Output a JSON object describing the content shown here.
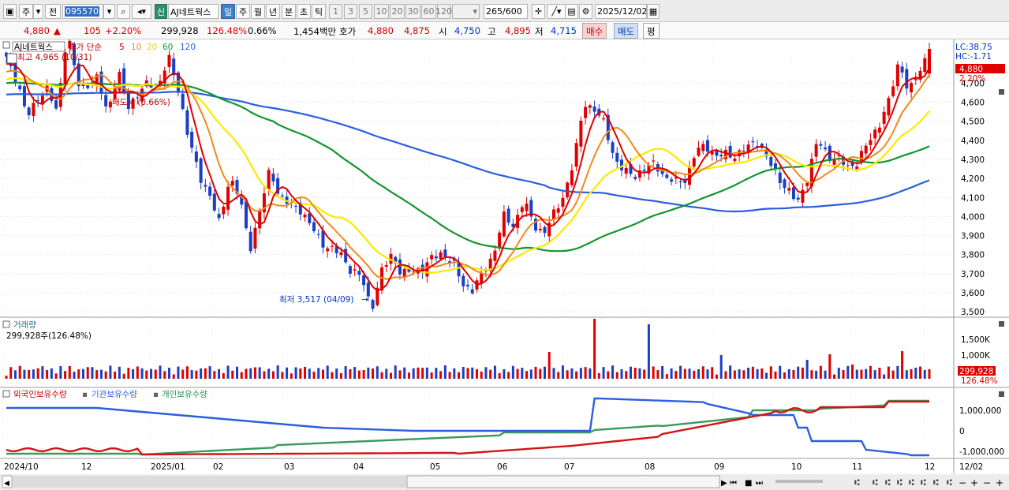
{
  "toolbar": {
    "period_ju": "주",
    "prev_label": "전",
    "code": "095570",
    "name": "AJ네트웍스",
    "sin": "신",
    "tabs": [
      "일",
      "주",
      "월",
      "년",
      "분",
      "초",
      "틱"
    ],
    "nums": [
      "1",
      "3",
      "5",
      "10",
      "20",
      "30",
      "60",
      "120"
    ],
    "count": "265",
    "count_total": "/600",
    "date": "2025/12/02",
    "icons": [
      "layout-icon",
      "dropdown-arrow-icon",
      "search-icon",
      "speaker-icon",
      "crosshair-icon",
      "chart-tools-icon",
      "save-icon",
      "settings-icon",
      "calendar-icon"
    ]
  },
  "quote": {
    "price": "4,880",
    "arrow": "▲",
    "change": "105",
    "change_pct": "+2.20%",
    "volume": "299,928",
    "vol_pct": "126.48%",
    "turnover": "0.66%",
    "amount": "1,454백만",
    "hoga_label": "호가",
    "hoga_ask": "4,880",
    "hoga_bid": "4,875",
    "open_label": "시",
    "open": "4,750",
    "high_label": "고",
    "high": "4,895",
    "low_label": "저",
    "low": "4,715",
    "buy": "매수",
    "sell": "매도",
    "pyeong": "평"
  },
  "price_panel": {
    "stock_name": "AJ네트웍스",
    "ma_title": "종가 단순",
    "ma_periods": [
      "5",
      "10",
      "20",
      "60",
      "120"
    ],
    "max_label": "최고 4,965 (10/31)",
    "min_label": "최저 3,517 (04/09)",
    "mid_label": "매도세 (0.66%)",
    "lc": "LC:38.75",
    "hc": "HC:-1.71",
    "price_tag": "4,880",
    "pct_tag": "2.20%",
    "ticks": [
      "4,700",
      "4,600",
      "4,500",
      "4,400",
      "4,300",
      "4,200",
      "4,100",
      "4,000",
      "3,900",
      "3,800",
      "3,700",
      "3,600",
      "3,500"
    ]
  },
  "volume_panel": {
    "title": "거래량",
    "info": "299,928주(126.48%)",
    "ticks": [
      "1,500K",
      "1,000K"
    ],
    "tag": "299,928",
    "pct": "126.48%"
  },
  "holdings_panel": {
    "titles": [
      "외국인보유수량",
      "기관보유수량",
      "개인보유수량"
    ],
    "ticks": [
      "1,000,000",
      "0",
      "-1,000,000"
    ]
  },
  "xaxis": {
    "labels": [
      "2024/10",
      "12",
      "2025/01",
      "02",
      "03",
      "04",
      "05",
      "06",
      "07",
      "08",
      "09",
      "10",
      "11",
      "12"
    ],
    "end_label": "12/02"
  },
  "colors": {
    "up": "#e00000",
    "down": "#1a3fc4",
    "ma5": "#e00000",
    "ma10": "#f08a1a",
    "ma20": "#ffe800",
    "ma60": "#12962f",
    "ma120": "#2b5fe0",
    "foreign": "#d41414",
    "inst": "#2b5fe0",
    "indiv": "#3a9a5c"
  },
  "chart_data": {
    "type": "candlestick",
    "title": "AJ네트웍스",
    "series": [
      "종가 단순 5",
      "10",
      "20",
      "60",
      "120"
    ],
    "yrange": [
      3480,
      4830
    ],
    "keypoints": [
      [
        "10/01",
        4840
      ],
      [
        "10/03",
        4720
      ],
      [
        "10/08",
        4520
      ],
      [
        "10/15",
        4620
      ],
      [
        "10/22",
        4660
      ],
      [
        "10/25",
        4560
      ],
      [
        "10/31",
        4965
      ],
      [
        "11/04",
        4700
      ],
      [
        "11/07",
        4690
      ],
      [
        "11/12",
        4720
      ],
      [
        "11/15",
        4550
      ],
      [
        "11/20",
        4760
      ],
      [
        "11/25",
        4580
      ],
      [
        "11/29",
        4640
      ],
      [
        "12/04",
        4700
      ],
      [
        "12/08",
        4690
      ],
      [
        "12/12",
        4830
      ],
      [
        "12/16",
        4660
      ],
      [
        "12/20",
        4400
      ],
      [
        "12/30",
        4220
      ],
      [
        "01/10",
        4120
      ],
      [
        "01/17",
        3960
      ],
      [
        "01/20",
        4210
      ],
      [
        "01/24",
        4100
      ],
      [
        "01/31",
        3830
      ],
      [
        "02/04",
        4030
      ],
      [
        "02/07",
        4250
      ],
      [
        "02/12",
        4100
      ],
      [
        "02/18",
        4060
      ],
      [
        "02/25",
        4040
      ],
      [
        "03/04",
        3950
      ],
      [
        "03/07",
        3870
      ],
      [
        "03/12",
        3830
      ],
      [
        "03/19",
        3800
      ],
      [
        "03/26",
        3720
      ],
      [
        "04/01",
        3680
      ],
      [
        "04/09",
        3517
      ],
      [
        "04/12",
        3710
      ],
      [
        "04/16",
        3800
      ],
      [
        "04/20",
        3700
      ],
      [
        "04/25",
        3710
      ],
      [
        "04/30",
        3730
      ],
      [
        "05/05",
        3780
      ],
      [
        "05/10",
        3810
      ],
      [
        "05/15",
        3760
      ],
      [
        "05/20",
        3640
      ],
      [
        "05/27",
        3620
      ],
      [
        "05/30",
        3700
      ],
      [
        "06/04",
        3800
      ],
      [
        "06/08",
        4000
      ],
      [
        "06/12",
        3950
      ],
      [
        "06/16",
        4090
      ],
      [
        "06/20",
        3950
      ],
      [
        "06/24",
        3920
      ],
      [
        "06/28",
        4010
      ],
      [
        "07/02",
        4120
      ],
      [
        "07/08",
        4300
      ],
      [
        "07/12",
        4600
      ],
      [
        "07/15",
        4560
      ],
      [
        "07/18",
        4480
      ],
      [
        "07/22",
        4300
      ],
      [
        "07/28",
        4230
      ],
      [
        "08/04",
        4220
      ],
      [
        "08/08",
        4250
      ],
      [
        "08/12",
        4280
      ],
      [
        "08/18",
        4200
      ],
      [
        "08/22",
        4180
      ],
      [
        "08/28",
        4200
      ],
      [
        "09/01",
        4340
      ],
      [
        "09/06",
        4380
      ],
      [
        "09/10",
        4310
      ],
      [
        "09/15",
        4330
      ],
      [
        "09/20",
        4320
      ],
      [
        "09/25",
        4360
      ],
      [
        "10/01",
        4400
      ],
      [
        "10/05",
        4300
      ],
      [
        "10/10",
        4220
      ],
      [
        "10/15",
        4140
      ],
      [
        "10/18",
        4070
      ],
      [
        "10/22",
        4210
      ],
      [
        "10/26",
        4400
      ],
      [
        "10/30",
        4320
      ],
      [
        "11/03",
        4300
      ],
      [
        "11/06",
        4260
      ],
      [
        "11/10",
        4290
      ],
      [
        "11/14",
        4390
      ],
      [
        "11/18",
        4480
      ],
      [
        "11/22",
        4600
      ],
      [
        "11/26",
        4820
      ],
      [
        "11/28",
        4650
      ],
      [
        "12/01",
        4760
      ],
      [
        "12/02",
        4880
      ]
    ]
  }
}
